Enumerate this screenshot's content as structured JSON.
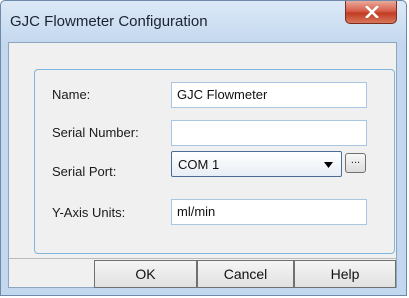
{
  "window": {
    "title": "GJC Flowmeter Configuration",
    "close_icon": "close-x-icon"
  },
  "form": {
    "name_label": "Name:",
    "name_value": "GJC Flowmeter",
    "serial_number_label": "Serial Number:",
    "serial_number_value": "",
    "serial_port_label": "Serial Port:",
    "serial_port_value": "COM 1",
    "browse_label": "...",
    "y_axis_units_label": "Y-Axis Units:",
    "y_axis_units_value": "ml/min"
  },
  "buttons": {
    "ok_label": "OK",
    "cancel_label": "Cancel",
    "help_label": "Help"
  },
  "colors": {
    "title_bar": "#c4d8ef",
    "close_button": "#c23c22",
    "group_border": "#7fb4dc"
  }
}
